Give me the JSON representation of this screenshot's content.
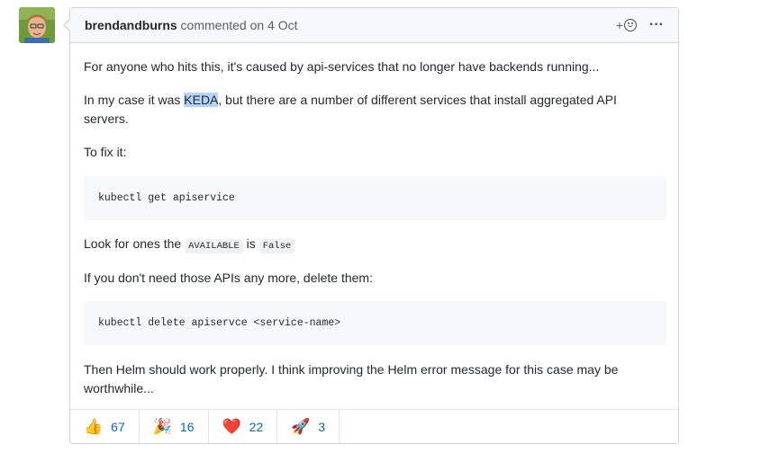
{
  "comment": {
    "author": "brendandburns",
    "action_text": " commented on 4 Oct",
    "add_reaction_label": "+",
    "more_label": "···",
    "paragraphs": {
      "p1": "For anyone who hits this, it's caused by api-services that no longer have backends running...",
      "p2_before": "In my case it was ",
      "p2_highlight": "KEDA",
      "p2_after": ", but there are a number of different services that install aggregated API servers.",
      "p3": "To fix it:",
      "code1": "kubectl get apiservice",
      "p4_before": "Look for ones the ",
      "p4_code1": "AVAILABLE",
      "p4_mid": " is ",
      "p4_code2": "False",
      "p5": "If you don't need those APIs any more, delete them:",
      "code2": "kubectl delete apiservce <service-name>",
      "p6": "Then Helm should work properly. I think improving the Helm error message for this case may be worthwhile..."
    },
    "reactions": [
      {
        "emoji": "👍",
        "icon": "thumbs-up-icon",
        "count": "67"
      },
      {
        "emoji": "🎉",
        "icon": "party-popper-icon",
        "count": "16"
      },
      {
        "emoji": "❤️",
        "icon": "heart-icon",
        "count": "22"
      },
      {
        "emoji": "🚀",
        "icon": "rocket-icon",
        "count": "3"
      }
    ]
  },
  "colors": {
    "link": "#0366d6",
    "header_bg": "#f6f8fa",
    "border": "#d1d5da",
    "selection": "#b3d4fc"
  }
}
